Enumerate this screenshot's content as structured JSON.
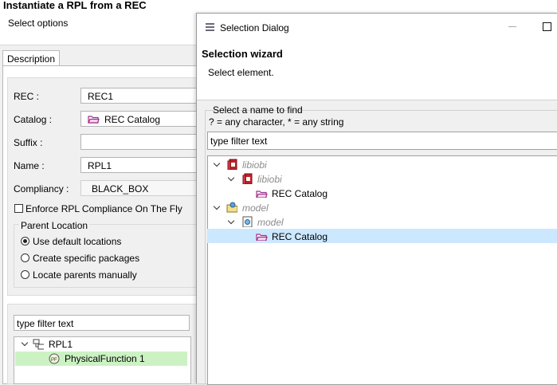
{
  "main": {
    "title": "Instantiate a RPL from a REC",
    "subtitle": "Select options",
    "tab": "Description",
    "form": {
      "rec_label": "REC :",
      "rec_value": "REC1",
      "catalog_label": "Catalog :",
      "catalog_value": "REC Catalog",
      "suffix_label": "Suffix :",
      "suffix_value": "",
      "name_label": "Name :",
      "name_value": "RPL1",
      "compliancy_label": "Compliancy :",
      "compliancy_value": "BLACK_BOX",
      "enforce_label": "Enforce RPL Compliance On The Fly",
      "enforce_checked": false
    },
    "parent_location": {
      "title": "Parent Location",
      "options": [
        "Use default locations",
        "Create specific packages",
        "Locate parents manually"
      ],
      "selected": "Use default locations"
    },
    "bottom": {
      "filter_value": "type filter text",
      "tree": [
        {
          "label": "RPL1",
          "icon": "rpl-icon"
        },
        {
          "label": "PhysicalFunction 1",
          "icon": "physical-function-icon"
        }
      ]
    }
  },
  "dialog": {
    "window_title": "Selection Dialog",
    "header_title": "Selection wizard",
    "header_subtitle": "Select element.",
    "find_label_1": "Select a name to find",
    "find_label_2": "? = any character, * = any string",
    "filter_value": "type filter text",
    "tree": [
      {
        "label": "libiobi",
        "icon": "library-icon",
        "grey": true
      },
      {
        "label": "libiobi",
        "icon": "library-model-icon",
        "grey": true
      },
      {
        "label": "REC Catalog",
        "icon": "catalog-folder-icon",
        "grey": false
      },
      {
        "label": "model",
        "icon": "model-folder-icon",
        "grey": true
      },
      {
        "label": "model",
        "icon": "model-icon",
        "grey": true
      },
      {
        "label": "REC Catalog",
        "icon": "catalog-folder-icon",
        "grey": false,
        "selected": true
      }
    ]
  },
  "colors": {
    "selection_blue": "#cce8ff",
    "selection_green": "#ccf2c4",
    "folder_purple": "#a0308a",
    "library_red": "#c0202a"
  }
}
